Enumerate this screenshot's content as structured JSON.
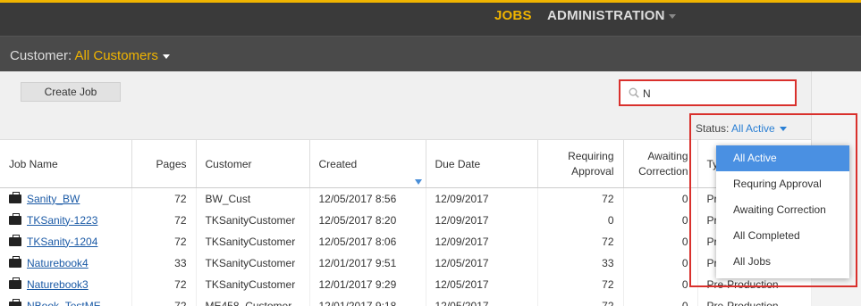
{
  "nav": {
    "jobs": "JOBS",
    "administration": "ADMINISTRATION"
  },
  "customer": {
    "label": "Customer:",
    "value": "All Customers"
  },
  "toolbar": {
    "create_job": "Create Job"
  },
  "search": {
    "value": "N"
  },
  "status": {
    "label": "Status:",
    "value": "All Active",
    "options": [
      "All Active",
      "Requring Approval",
      "Awaiting Correction",
      "All Completed",
      "All Jobs"
    ],
    "selected_index": 0
  },
  "table": {
    "headers": {
      "job_name": "Job Name",
      "pages": "Pages",
      "customer": "Customer",
      "created": "Created",
      "due_date": "Due Date",
      "requiring_1": "Requiring",
      "requiring_2": "Approval",
      "awaiting_1": "Awaiting",
      "awaiting_2": "Correction",
      "type": "Ty"
    },
    "rows": [
      {
        "job": "Sanity_BW",
        "pages": "72",
        "customer": "BW_Cust",
        "created": "12/05/2017 8:56",
        "due": "12/09/2017",
        "requiring": "72",
        "awaiting": "0",
        "type": "Pr"
      },
      {
        "job": "TKSanity-1223",
        "pages": "72",
        "customer": "TKSanityCustomer",
        "created": "12/05/2017 8:20",
        "due": "12/09/2017",
        "requiring": "0",
        "awaiting": "0",
        "type": "Pr"
      },
      {
        "job": "TKSanity-1204",
        "pages": "72",
        "customer": "TKSanityCustomer",
        "created": "12/05/2017 8:06",
        "due": "12/09/2017",
        "requiring": "72",
        "awaiting": "0",
        "type": "Pr"
      },
      {
        "job": "Naturebook4",
        "pages": "33",
        "customer": "TKSanityCustomer",
        "created": "12/01/2017 9:51",
        "due": "12/05/2017",
        "requiring": "33",
        "awaiting": "0",
        "type": "Pr"
      },
      {
        "job": "Naturebook3",
        "pages": "72",
        "customer": "TKSanityCustomer",
        "created": "12/01/2017 9:29",
        "due": "12/05/2017",
        "requiring": "72",
        "awaiting": "0",
        "type": "Pre-Production"
      },
      {
        "job": "NBook_TestME",
        "pages": "72",
        "customer": "ME458_Customer",
        "created": "12/01/2017 9:18",
        "due": "12/05/2017",
        "requiring": "72",
        "awaiting": "0",
        "type": "Pre-Production"
      }
    ]
  }
}
